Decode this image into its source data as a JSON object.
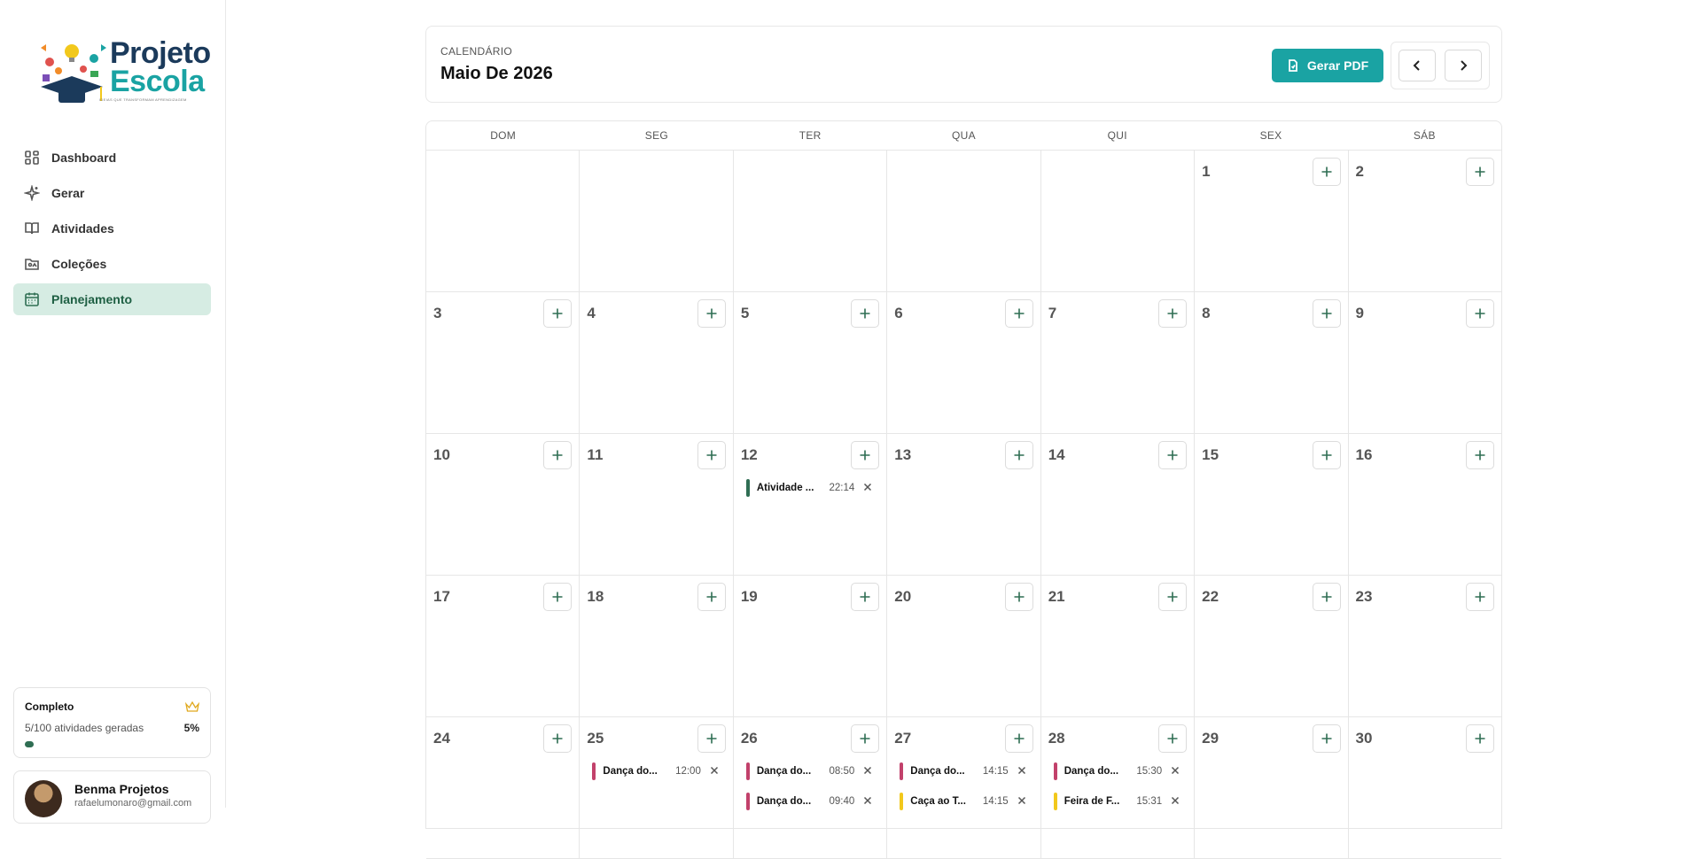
{
  "brand": {
    "line1": "Projeto",
    "line2": "Escola",
    "tagline": "IDEIAS QUE TRANSFORMAM APRENDIZAGEM"
  },
  "sidebar": {
    "items": [
      {
        "label": "Dashboard",
        "icon": "grid-icon",
        "active": false
      },
      {
        "label": "Gerar",
        "icon": "sparkle-icon",
        "active": false
      },
      {
        "label": "Atividades",
        "icon": "book-icon",
        "active": false
      },
      {
        "label": "Coleções",
        "icon": "folder-icon",
        "active": false
      },
      {
        "label": "Planejamento",
        "icon": "calendar-icon",
        "active": true
      }
    ],
    "plan": {
      "name": "Completo",
      "usage": "5/100 atividades geradas",
      "percent": "5%",
      "progress_fraction": 0.05
    },
    "user": {
      "name": "Benma Projetos",
      "email": "rafaelumonaro@gmail.com"
    }
  },
  "header": {
    "eyebrow": "CALENDÁRIO",
    "month": "Maio De 2026",
    "pdf_button": "Gerar PDF"
  },
  "calendar": {
    "weekdays": [
      "DOM",
      "SEG",
      "TER",
      "QUA",
      "QUI",
      "SEX",
      "SÁB"
    ],
    "weeks": [
      [
        null,
        null,
        null,
        null,
        null,
        1,
        2
      ],
      [
        3,
        4,
        5,
        6,
        7,
        8,
        9
      ],
      [
        10,
        11,
        12,
        13,
        14,
        15,
        16
      ],
      [
        17,
        18,
        19,
        20,
        21,
        22,
        23
      ],
      [
        24,
        25,
        26,
        27,
        28,
        29,
        30
      ]
    ],
    "events": {
      "12": [
        {
          "title": "Atividade ...",
          "time": "22:14",
          "color": "#2f6e53"
        }
      ],
      "25": [
        {
          "title": "Dança do...",
          "time": "12:00",
          "color": "#c2416b"
        }
      ],
      "26": [
        {
          "title": "Dança do...",
          "time": "08:50",
          "color": "#c2416b"
        },
        {
          "title": "Dança do...",
          "time": "09:40",
          "color": "#c2416b"
        }
      ],
      "27": [
        {
          "title": "Dança do...",
          "time": "14:15",
          "color": "#c2416b"
        },
        {
          "title": "Caça ao T...",
          "time": "14:15",
          "color": "#f2c81c"
        }
      ],
      "28": [
        {
          "title": "Dança do...",
          "time": "15:30",
          "color": "#c2416b"
        },
        {
          "title": "Feira de F...",
          "time": "15:31",
          "color": "#f2c81c"
        }
      ]
    }
  },
  "colors": {
    "primary": "#1aa3a3",
    "active_bg": "#d6ece3",
    "active_text": "#1e5f43"
  }
}
